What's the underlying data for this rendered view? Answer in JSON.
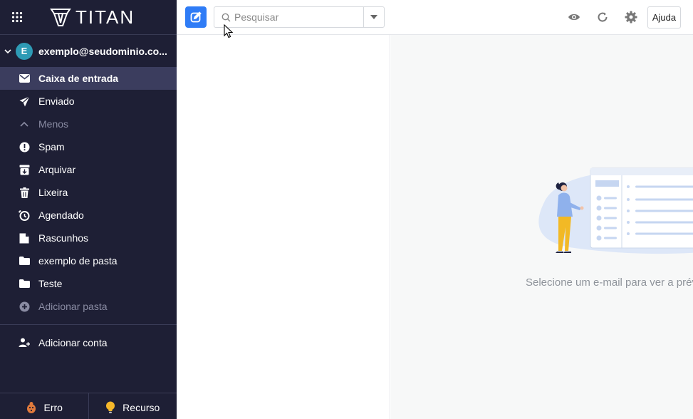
{
  "app": {
    "brand": "TITAN"
  },
  "sidebar": {
    "account": {
      "initial": "E",
      "email": "exemplo@seudominio.co..."
    },
    "folders": [
      {
        "label": "Caixa de entrada",
        "icon": "envelope-icon",
        "state": "active"
      },
      {
        "label": "Enviado",
        "icon": "paper-plane-icon",
        "state": "normal"
      },
      {
        "label": "Menos",
        "icon": "chevron-up-icon",
        "state": "muted"
      },
      {
        "label": "Spam",
        "icon": "exclamation-circle-icon",
        "state": "normal"
      },
      {
        "label": "Arquivar",
        "icon": "archive-icon",
        "state": "normal"
      },
      {
        "label": "Lixeira",
        "icon": "trash-icon",
        "state": "normal"
      },
      {
        "label": "Agendado",
        "icon": "clock-icon",
        "state": "normal"
      },
      {
        "label": "Rascunhos",
        "icon": "draft-icon",
        "state": "normal"
      },
      {
        "label": "exemplo de pasta",
        "icon": "folder-icon",
        "state": "normal"
      },
      {
        "label": "Teste",
        "icon": "folder-icon",
        "state": "normal"
      },
      {
        "label": "Adicionar pasta",
        "icon": "plus-circle-icon",
        "state": "muted"
      }
    ],
    "add_account_label": "Adicionar conta",
    "footer": {
      "bug_label": "Erro",
      "feature_label": "Recurso"
    }
  },
  "toolbar": {
    "search_placeholder": "Pesquisar",
    "help_label": "Ajuda"
  },
  "preview": {
    "empty_message": "Selecione um e-mail para ver a prévia"
  },
  "colors": {
    "sidebar_bg": "#1e1f35",
    "active_folder_bg": "#3b3d5e",
    "accent": "#2f7cf6",
    "avatar": "#2e9bb5"
  }
}
